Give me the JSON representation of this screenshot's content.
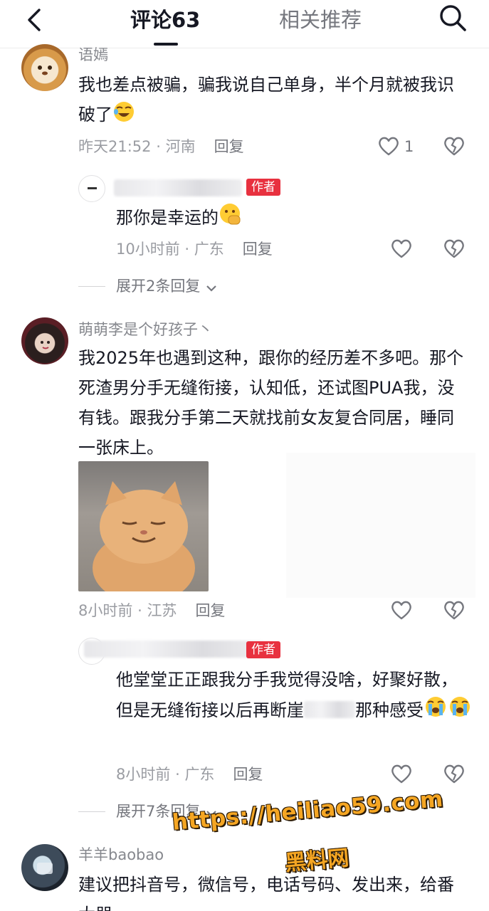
{
  "header": {
    "tab_comments": "评论63",
    "tab_related": "相关推荐"
  },
  "comments": [
    {
      "username": "语嫣",
      "text": "我也差点被骗，骗我说自己单身，半个月就被我识破了",
      "time": "昨天21:52",
      "location": "河南",
      "reply_label": "回复",
      "likes": "1",
      "reply": {
        "author_tag": "作者",
        "text": "那你是幸运的",
        "time": "10小时前",
        "location": "广东",
        "reply_label": "回复"
      },
      "expand": "展开2条回复"
    },
    {
      "username": "萌萌李是个好孩子丶",
      "text": "我2025年也遇到这种，跟你的经历差不多吧。那个死渣男分手无缝衔接，认知低，还试图PUA我，没有钱。跟我分手第二天就找前女友复合同居，睡同一张床上。",
      "time": "8小时前",
      "location": "江苏",
      "reply_label": "回复",
      "reply": {
        "author_tag": "作者",
        "text": "他堂堂正正跟我分手我觉得没啥，好聚好散，但是无缝衔接以后再断崖",
        "text_tail": "那种感受",
        "time": "8小时前",
        "location": "广东",
        "reply_label": "回复"
      },
      "expand": "展开7条回复"
    },
    {
      "username": "羊羊baobao",
      "text": "建议把抖音号，微信号，电话号码、发出来，给番大器"
    }
  ],
  "watermark": {
    "url": "https://heiliao59.com",
    "name": "黑料网"
  },
  "colors": {
    "author_tag": "#e8313f",
    "watermark": "#f5a623"
  },
  "separator": "·"
}
